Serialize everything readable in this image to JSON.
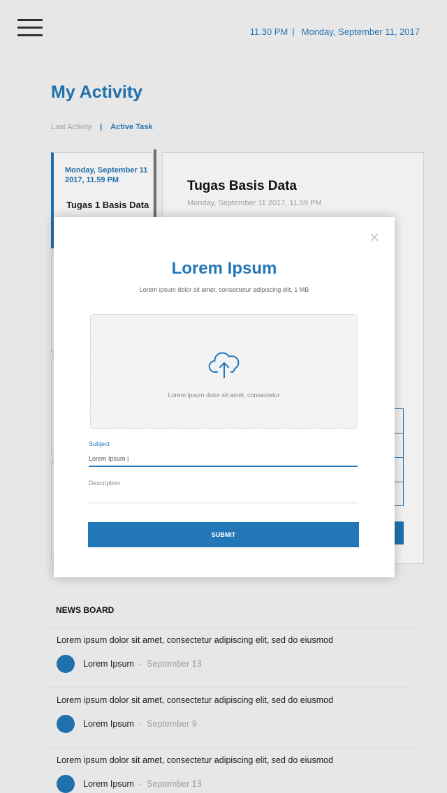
{
  "header": {
    "time": "11.30 PM",
    "separator": "|",
    "date": "Monday, September 11, 2017"
  },
  "page_title": "My Activity",
  "tabs": {
    "last_activity": "Last Activity",
    "separator": "|",
    "active_task": "Active Task"
  },
  "task_list": [
    {
      "date": "Monday, September 11 2017, 11.59 PM",
      "name": "Tugas 1 Basis Data",
      "active": true
    },
    {
      "date": "",
      "name": "",
      "active": false
    },
    {
      "date": "",
      "name": "",
      "active": false
    },
    {
      "date": "",
      "name": "",
      "active": false
    }
  ],
  "detail": {
    "title": "Tugas Basis Data",
    "date": "Monday, September 11 2017, 11.59 PM"
  },
  "news": {
    "title": "NEWS BOARD",
    "items": [
      {
        "headline": "Lorem ipsum dolor sit amet, consectetur adipiscing elit, sed do eiusmod",
        "author": "Lorem Ipsum",
        "separator": "-",
        "date": "September 13"
      },
      {
        "headline": "Lorem ipsum dolor sit amet, consectetur adipiscing elit, sed do eiusmod",
        "author": "Lorem Ipsum",
        "separator": "-",
        "date": "September 9"
      },
      {
        "headline": "Lorem ipsum dolor sit amet, consectetur adipiscing elit, sed do eiusmod",
        "author": "Lorem Ipsum",
        "separator": "-",
        "date": "September 13"
      }
    ]
  },
  "modal": {
    "close_symbol": "×",
    "title": "Lorem Ipsum",
    "subtitle": "Lorem ipsum dolor sit amet, consectetur adipiscing elit, 1 MB",
    "dropzone_text": "Lorem ipsum dolor sit amet, consectetur",
    "upload_icon": "cloud-upload-icon",
    "subject_label": "Subject",
    "subject_value": "Lorem Ipsum |",
    "description_label": "Description",
    "description_value": "",
    "submit_label": "SUBMIT"
  },
  "colors": {
    "accent": "#2277b8",
    "background": "#f6f6f6",
    "muted": "#aaaaaa"
  }
}
